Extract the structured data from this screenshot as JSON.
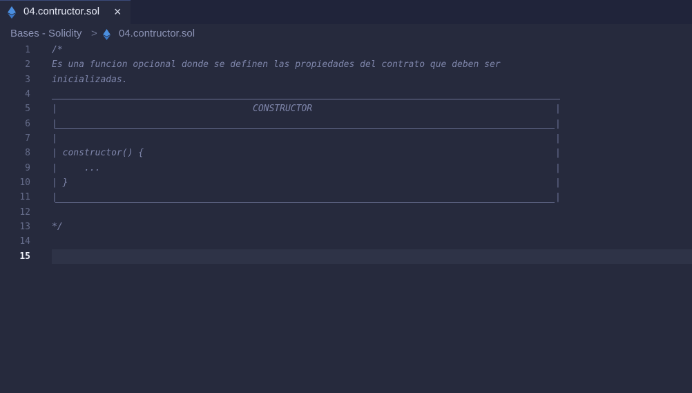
{
  "tab": {
    "filename": "04.contructor.sol",
    "close_glyph": "×",
    "icon": "ethereum-icon"
  },
  "breadcrumb": {
    "folder": "Bases - Solidity",
    "separator": ">",
    "file": "04.contructor.sol",
    "icon": "ethereum-icon"
  },
  "editor": {
    "line_numbers": [
      "1",
      "2",
      "3",
      "4",
      "5",
      "6",
      "7",
      "8",
      "9",
      "10",
      "11",
      "12",
      "13",
      "14",
      "15"
    ],
    "active_line": 15,
    "lines": {
      "l1": "/*",
      "l2": "Es una funcion opcional donde se definen las propiedades del contrato que deben ser",
      "l3": "inicializadas.",
      "l8": "  constructor() {",
      "l9": "      ...",
      "l10": "  }",
      "l13": "*/"
    },
    "box_title": "CONSTRUCTOR",
    "box_pipe": "|"
  },
  "colors": {
    "background": "#262a3d",
    "comment": "#7f86ab",
    "line_number": "#656c8a",
    "active_line_number": "#f0f2fa",
    "ethereum_icon": "#4b8fe0"
  }
}
